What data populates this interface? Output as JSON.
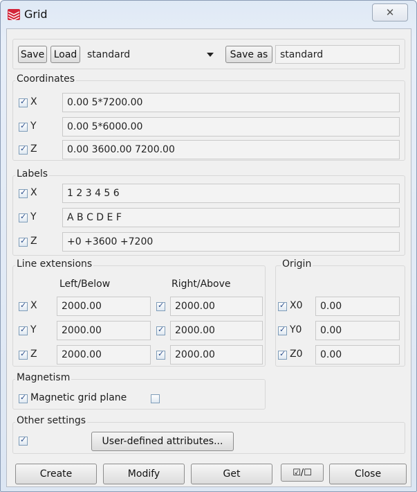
{
  "window": {
    "title": "Grid"
  },
  "toolbar": {
    "save": "Save",
    "load": "Load",
    "preset": "standard",
    "save_as": "Save as",
    "save_as_name": "standard"
  },
  "coordinates": {
    "title": "Coordinates",
    "rows": [
      {
        "axis": "X",
        "checked": true,
        "value": "0.00 5*7200.00"
      },
      {
        "axis": "Y",
        "checked": true,
        "value": "0.00 5*6000.00"
      },
      {
        "axis": "Z",
        "checked": true,
        "value": "0.00 3600.00 7200.00"
      }
    ]
  },
  "labels": {
    "title": "Labels",
    "rows": [
      {
        "axis": "X",
        "checked": true,
        "value": "1 2 3 4 5 6"
      },
      {
        "axis": "Y",
        "checked": true,
        "value": "A B C D E F"
      },
      {
        "axis": "Z",
        "checked": true,
        "value": "+0 +3600 +7200"
      }
    ]
  },
  "line_extensions": {
    "title": "Line extensions",
    "left_header": "Left/Below",
    "right_header": "Right/Above",
    "rows": [
      {
        "axis": "X",
        "left": "2000.00",
        "right": "2000.00"
      },
      {
        "axis": "Y",
        "left": "2000.00",
        "right": "2000.00"
      },
      {
        "axis": "Z",
        "left": "2000.00",
        "right": "2000.00"
      }
    ]
  },
  "origin": {
    "title": "Origin",
    "rows": [
      {
        "axis": "X0",
        "value": "0.00"
      },
      {
        "axis": "Y0",
        "value": "0.00"
      },
      {
        "axis": "Z0",
        "value": "0.00"
      }
    ]
  },
  "magnetism": {
    "title": "Magnetism",
    "label": "Magnetic grid plane"
  },
  "other": {
    "title": "Other settings",
    "udf_button": "User-defined attributes..."
  },
  "footer": {
    "create": "Create",
    "modify": "Modify",
    "get": "Get",
    "toggle": "☑/☐",
    "close": "Close"
  }
}
